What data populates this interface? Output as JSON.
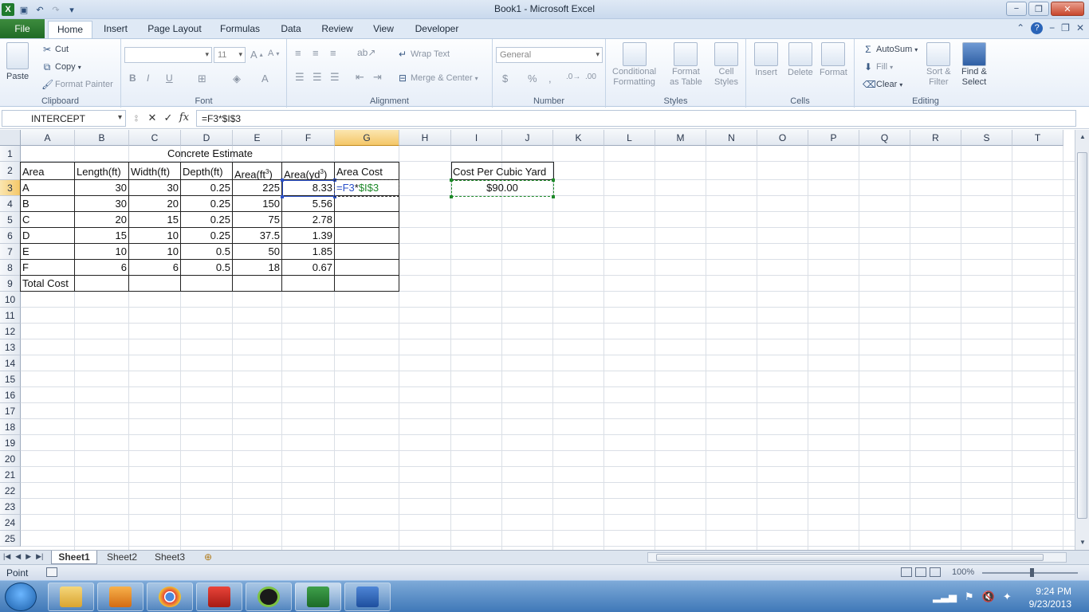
{
  "window": {
    "title": "Book1 - Microsoft Excel",
    "minimize": "−",
    "restore": "❐",
    "close": "✕"
  },
  "ribbon_tabs": [
    "File",
    "Home",
    "Insert",
    "Page Layout",
    "Formulas",
    "Data",
    "Review",
    "View",
    "Developer"
  ],
  "ribbon": {
    "clipboard": {
      "label": "Clipboard",
      "paste": "Paste",
      "cut": "Cut",
      "copy": "Copy",
      "format_painter": "Format Painter"
    },
    "font": {
      "label": "Font",
      "font_name": "",
      "font_size": "11"
    },
    "alignment": {
      "label": "Alignment",
      "wrap_text": "Wrap Text",
      "merge_center": "Merge & Center"
    },
    "number": {
      "label": "Number",
      "format": "General"
    },
    "styles": {
      "label": "Styles",
      "conditional_1": "Conditional",
      "conditional_2": "Formatting",
      "format_table_1": "Format",
      "format_table_2": "as Table",
      "cell_styles_1": "Cell",
      "cell_styles_2": "Styles"
    },
    "cells": {
      "label": "Cells",
      "insert": "Insert",
      "delete": "Delete",
      "format": "Format"
    },
    "editing": {
      "label": "Editing",
      "autosum": "AutoSum",
      "fill": "Fill",
      "clear": "Clear",
      "sort_1": "Sort &",
      "sort_2": "Filter",
      "find_1": "Find &",
      "find_2": "Select"
    }
  },
  "formula_bar": {
    "name_box": "INTERCEPT",
    "formula": "=F3*$I$3",
    "fx": "fx"
  },
  "columns": [
    "A",
    "B",
    "C",
    "D",
    "E",
    "F",
    "G",
    "H",
    "I",
    "J",
    "K",
    "L",
    "M",
    "N",
    "O",
    "P",
    "Q",
    "R",
    "S",
    "T"
  ],
  "rows": [
    "1",
    "2",
    "3",
    "4",
    "5",
    "6",
    "7",
    "8",
    "9",
    "10",
    "11",
    "12",
    "13",
    "14",
    "15",
    "16",
    "17",
    "18",
    "19",
    "20",
    "21",
    "22",
    "23",
    "24",
    "25"
  ],
  "sheet": {
    "title": "Concrete Estimate",
    "headers": [
      "Area",
      "Length(ft)",
      "Width(ft)",
      "Depth(ft)",
      "Area(ft",
      "Area(yd",
      "Area Cost"
    ],
    "superscript": "3",
    "data": [
      [
        "A",
        "30",
        "30",
        "0.25",
        "225",
        "8.33"
      ],
      [
        "B",
        "30",
        "20",
        "0.25",
        "150",
        "5.56"
      ],
      [
        "C",
        "20",
        "15",
        "0.25",
        "75",
        "2.78"
      ],
      [
        "D",
        "15",
        "10",
        "0.25",
        "37.5",
        "1.39"
      ],
      [
        "E",
        "10",
        "10",
        "0.5",
        "50",
        "1.85"
      ],
      [
        "F",
        "6",
        "6",
        "0.5",
        "18",
        "0.67"
      ]
    ],
    "total_label": "Total Cost",
    "editing_formula_ref1": "=F3",
    "editing_formula_op": "*",
    "editing_formula_ref2": "$I$3",
    "cost_label": "Cost Per Cubic Yard",
    "cost_value": "$90.00"
  },
  "sheet_tabs": [
    "Sheet1",
    "Sheet2",
    "Sheet3"
  ],
  "status": {
    "mode": "Point",
    "zoom": "100%"
  },
  "clock": {
    "time": "9:24 PM",
    "date": "9/23/2013"
  },
  "colors": {
    "ref_blue": "#2b50c8",
    "ref_green": "#1f8a2a",
    "file_tab": "#2a7a30"
  }
}
